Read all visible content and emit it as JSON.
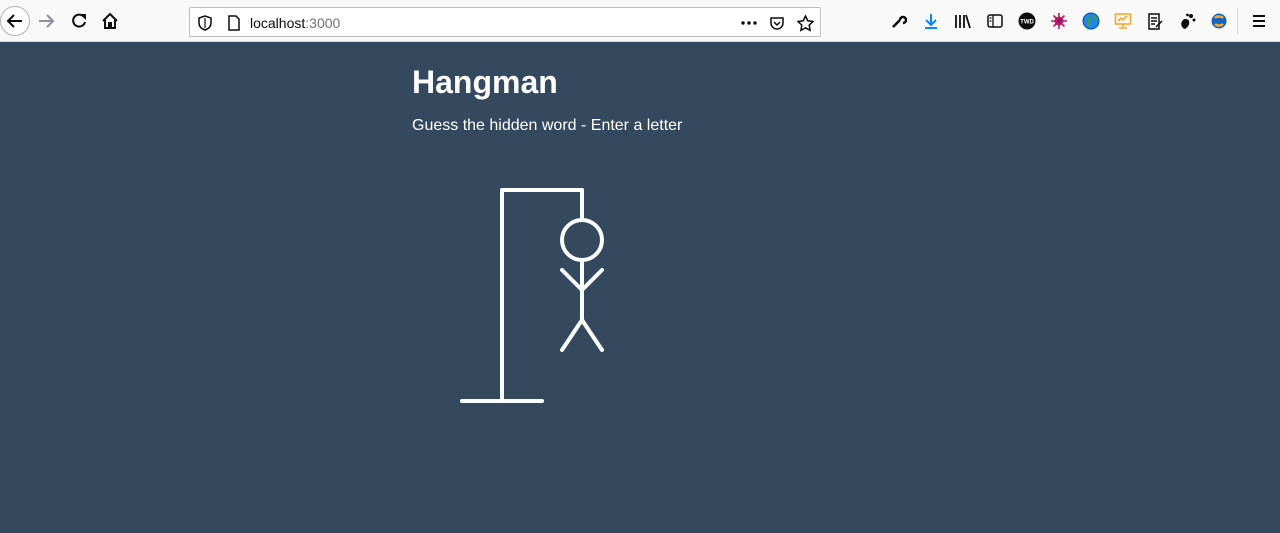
{
  "browser": {
    "url_host": "localhost",
    "url_port": ":3000",
    "icons": [
      "back-arrow-icon",
      "forward-arrow-icon",
      "reload-icon",
      "home-icon",
      "site-info-shield-icon",
      "page-icon",
      "more-actions-icon",
      "pocket-icon",
      "bookmark-star-icon",
      "wrench-icon",
      "download-icon",
      "library-icon",
      "sidebar-icon",
      "extension-twd-icon",
      "extension-virus-icon",
      "extension-globe-icon",
      "extension-monitor-icon",
      "extension-notes-icon",
      "extension-gnome-icon",
      "extension-python-icon",
      "menu-icon"
    ]
  },
  "page": {
    "title": "Hangman",
    "subtitle": "Guess the hidden word - Enter a letter"
  },
  "colors": {
    "background": "#34495e",
    "figure_stroke": "#ffffff",
    "text": "#ffffff"
  }
}
